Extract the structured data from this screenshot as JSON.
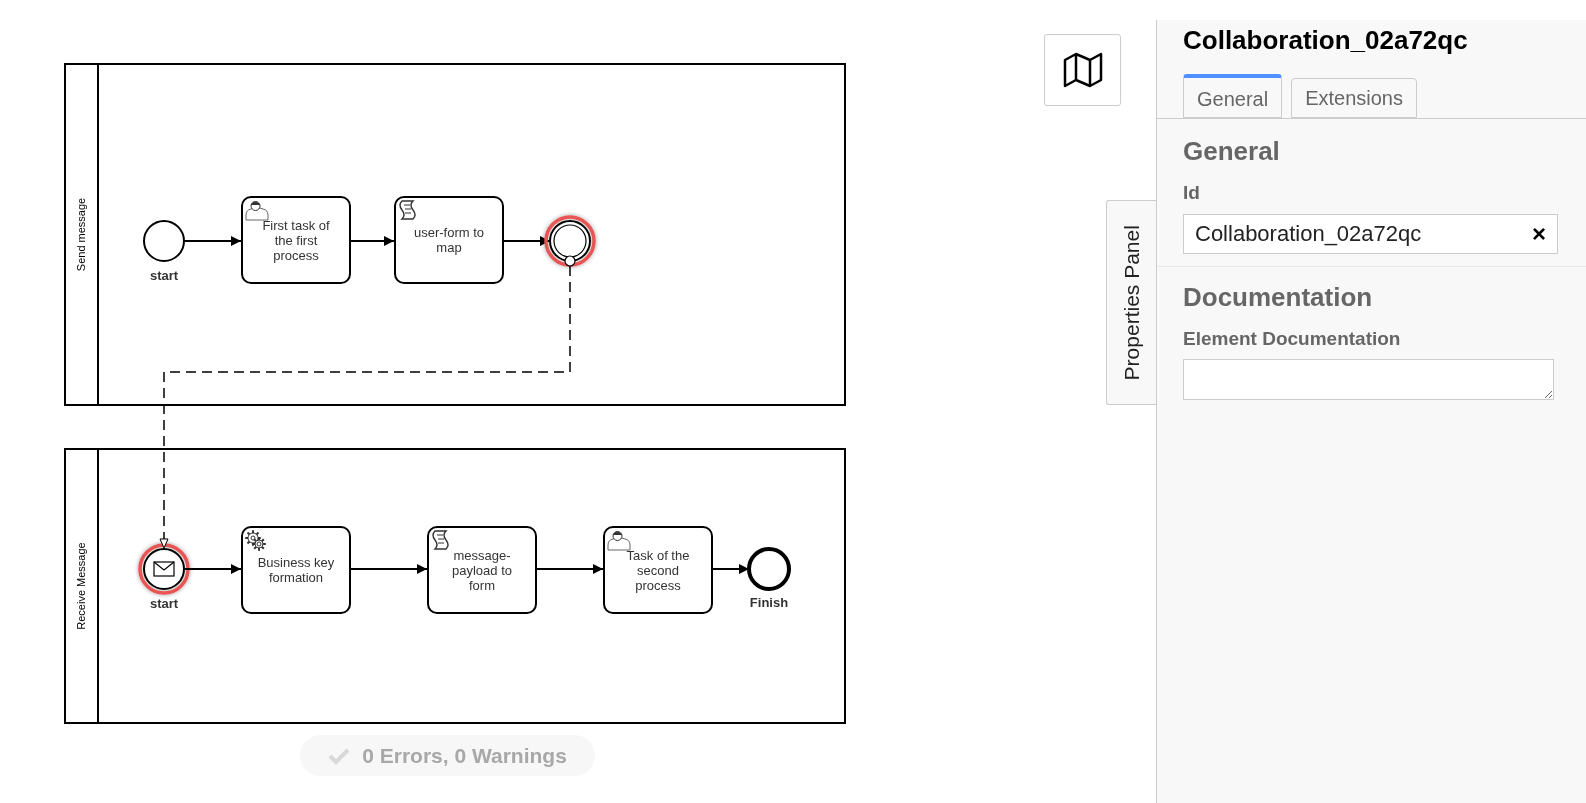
{
  "pools": [
    {
      "label": "Send message",
      "elements": [
        {
          "kind": "start_event",
          "label": "start",
          "highlighted": false
        },
        {
          "kind": "user_task",
          "label": "First task of the first process"
        },
        {
          "kind": "script_task",
          "label": "user-form to map"
        },
        {
          "kind": "intermediate_event",
          "highlighted": true
        }
      ]
    },
    {
      "label": "Receive Message",
      "elements": [
        {
          "kind": "message_start_event",
          "label": "start",
          "highlighted": true
        },
        {
          "kind": "service_task",
          "label": "Business key formation"
        },
        {
          "kind": "script_task",
          "label": "message-payload to form"
        },
        {
          "kind": "user_task",
          "label": "Task of the second process"
        },
        {
          "kind": "end_event",
          "label": "Finish",
          "highlighted": false
        }
      ]
    }
  ],
  "linting": {
    "text": "0 Errors, 0 Warnings"
  },
  "properties_panel": {
    "toggle_label": "Properties Panel",
    "title": "Collaboration_02a72qc",
    "tabs": [
      {
        "label": "General",
        "selected": true
      },
      {
        "label": "Extensions",
        "selected": false
      }
    ],
    "groups": [
      {
        "heading": "General",
        "field_label": "Id",
        "kind": "text",
        "value": "Collaboration_02a72qc",
        "clear": "×"
      },
      {
        "heading": "Documentation",
        "field_label": "Element Documentation",
        "kind": "textarea"
      }
    ]
  }
}
